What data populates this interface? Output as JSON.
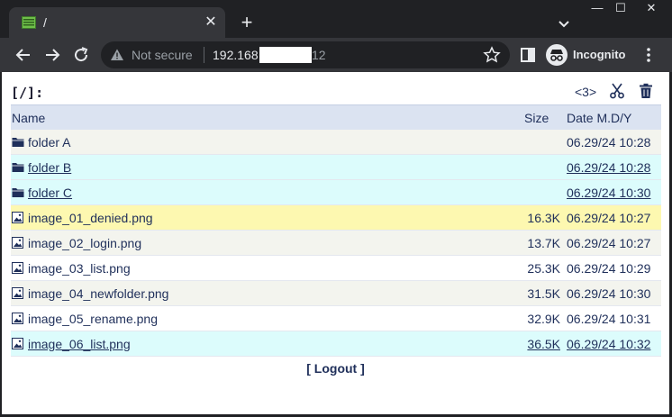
{
  "browser": {
    "tab_title": "/",
    "tab_close": "✕",
    "new_tab": "+",
    "window_controls": [
      "—",
      "☐",
      "✕"
    ],
    "omnibox": {
      "security_text": "Not secure",
      "url_visible_prefix": "192.168",
      "url_visible_suffix": "12"
    },
    "profile_label": "Incognito"
  },
  "page": {
    "path_label": "[/]:",
    "page_count": "<3>",
    "columns": {
      "name": "Name",
      "size": "Size",
      "date": "Date M.D/Y"
    },
    "rows": [
      {
        "kind": "folder",
        "name": "folder A",
        "size": "",
        "date": "06.29/24 10:28",
        "bg": "#f3f4ee",
        "underline": false
      },
      {
        "kind": "folder",
        "name": "folder B",
        "size": "",
        "date": "06.29/24 10:28",
        "bg": "#dcfcfc",
        "underline": true
      },
      {
        "kind": "folder",
        "name": "folder C",
        "size": "",
        "date": "06.29/24 10:30",
        "bg": "#dcfcfc",
        "underline": true
      },
      {
        "kind": "image",
        "name": "image_01_denied.png",
        "size": "16.3K",
        "date": "06.29/24 10:27",
        "bg": "#fdf8b0",
        "underline": false
      },
      {
        "kind": "image",
        "name": "image_02_login.png",
        "size": "13.7K",
        "date": "06.29/24 10:27",
        "bg": "#f3f4ee",
        "underline": false
      },
      {
        "kind": "image",
        "name": "image_03_list.png",
        "size": "25.3K",
        "date": "06.29/24 10:29",
        "bg": "#ffffff",
        "underline": false
      },
      {
        "kind": "image",
        "name": "image_04_newfolder.png",
        "size": "31.5K",
        "date": "06.29/24 10:30",
        "bg": "#f3f4ee",
        "underline": false
      },
      {
        "kind": "image",
        "name": "image_05_rename.png",
        "size": "32.9K",
        "date": "06.29/24 10:31",
        "bg": "#ffffff",
        "underline": false
      },
      {
        "kind": "image",
        "name": "image_06_list.png",
        "size": "36.5K",
        "date": "06.29/24 10:32",
        "bg": "#dcfcfc",
        "underline": true
      }
    ],
    "logout_label": "[ Logout ]"
  },
  "icons": {
    "folder": "folder-icon",
    "image": "image-file-icon",
    "cut": "scissors-icon",
    "trash": "trash-icon"
  },
  "colors": {
    "accent": "#1f2f5a",
    "header_bg": "#dbe3f1",
    "highlight_yellow": "#fdf8b0",
    "highlight_cyan": "#dcfcfc",
    "row_alt": "#f3f4ee"
  }
}
